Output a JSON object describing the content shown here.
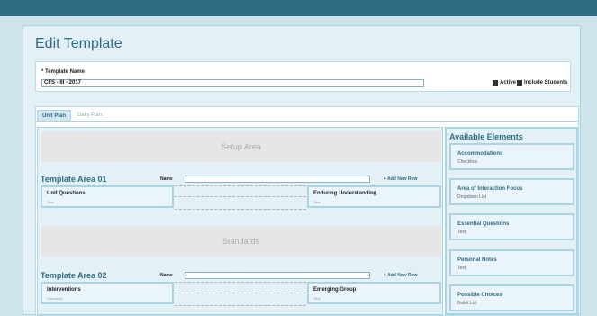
{
  "page": {
    "title": "Edit Template"
  },
  "template": {
    "name_label": "* Template Name",
    "name_value": "CFS - III - 2017",
    "active_label": "Active",
    "include_students_label": "Include Students"
  },
  "tabs": [
    {
      "label": "Unit Plan"
    },
    {
      "label": "Daily Plan"
    }
  ],
  "canvas": {
    "setup_label": "Setup Area",
    "standards_label": "Standards",
    "name_label": "Name",
    "add_row_label": "+ Add New Row",
    "area1": {
      "title": "Template Area 01",
      "cards": [
        {
          "title": "Unit Questions",
          "sub": "Text"
        },
        {
          "title": "Enduring Understanding",
          "sub": "Text"
        }
      ]
    },
    "area2": {
      "title": "Template Area 02",
      "cards": [
        {
          "title": "Interventions",
          "sub": "Checkbox"
        },
        {
          "title": "Emerging Group",
          "sub": "Text"
        }
      ]
    }
  },
  "available": {
    "title": "Available Elements",
    "items": [
      {
        "title": "Accommodations",
        "type": "Checkbox"
      },
      {
        "title": "Area of Interaction Focus",
        "type": "Dropdown List"
      },
      {
        "title": "Essential Questions",
        "type": "Text"
      },
      {
        "title": "Personal Notes",
        "type": "Text"
      },
      {
        "title": "Possible Choices",
        "type": "Bullet List"
      }
    ]
  }
}
